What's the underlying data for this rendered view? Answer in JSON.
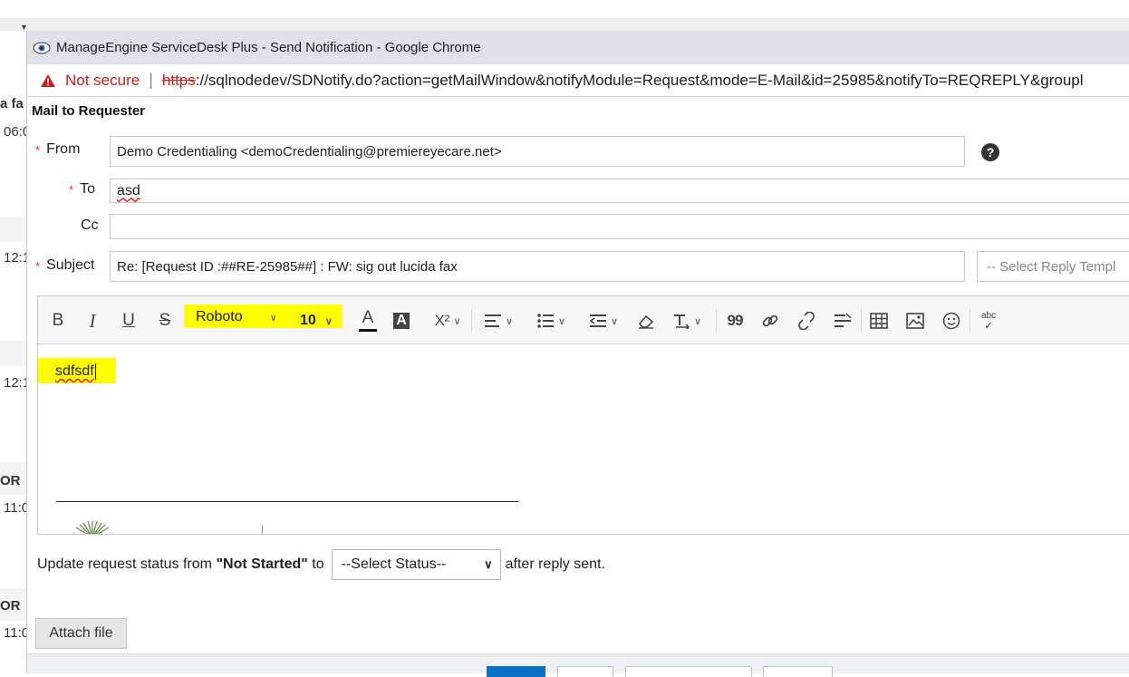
{
  "background_page": {
    "rows": [
      "a fa",
      "06:0",
      "12:1",
      "12:1",
      "OR",
      "11:0",
      "OR",
      "11:0"
    ]
  },
  "window": {
    "title": "ManageEngine ServiceDesk Plus - Send Notification - Google Chrome",
    "security_label": "Not secure",
    "url_scheme": "https",
    "url_rest": "://sqlnodedev/SDNotify.do?action=getMailWindow&notifyModule=Request&mode=E-Mail&id=25985&notifyTo=REQREPLY&groupl"
  },
  "dialog": {
    "title": "Mail to Requester",
    "from_label": "From",
    "from_value": "Demo Credentialing <demoCredentialing@premiereyecare.net>",
    "to_label": "To",
    "to_value": "asd",
    "cc_label": "Cc",
    "cc_value": "",
    "subject_label": "Subject",
    "subject_value": "Re: [Request ID :##RE-25985##] : FW: sig out lucida fax",
    "reply_template_placeholder": "-- Select Reply Templ",
    "required_mark": "*",
    "help_glyph": "?"
  },
  "toolbar": {
    "bold": "B",
    "italic": "I",
    "underline": "U",
    "strike": "S",
    "font_family": "Roboto",
    "font_size": "10",
    "font_color_glyph": "A",
    "bg_color_glyph": "A",
    "superscript_glyph": "X²",
    "quote_glyph": "99",
    "spell_glyph": "abc"
  },
  "editor": {
    "body_text": "sdfsdf"
  },
  "status": {
    "prefix": "Update request status from ",
    "current_status": "\"Not Started\"",
    "to_word": " to",
    "select_value": "--Select Status--",
    "suffix": "after reply sent."
  },
  "attach": {
    "label": "Attach file"
  },
  "colors": {
    "highlight": "#ffff00",
    "required": "#dd3333",
    "not_secure": "#c5221f",
    "footer_primary": "#0a72c6"
  }
}
